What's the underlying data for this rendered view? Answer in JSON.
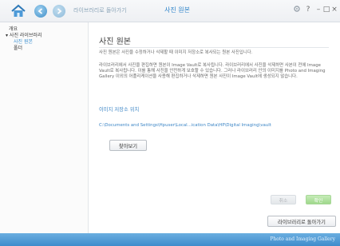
{
  "titlebar": {
    "breadcrumb": "라이브러리로 돌아가기",
    "title": "사진 원본",
    "window_controls": {
      "help_glyph": "?",
      "minimize_glyph": "–",
      "maximize_glyph": "□",
      "close_glyph": "×"
    },
    "icons": [
      "home-icon",
      "back-arrow-icon",
      "forward-arrow-icon",
      "settings-icon"
    ]
  },
  "sidebar": {
    "items": [
      {
        "label": "개요",
        "level": 0,
        "active": false
      },
      {
        "label": "▾ 사진 라이브러리",
        "level": 0,
        "active": false
      },
      {
        "label": "사진 원본",
        "level": 1,
        "active": true
      },
      {
        "label": "폴더",
        "level": 1,
        "active": false
      }
    ]
  },
  "main": {
    "heading": "사진 원본",
    "intro": "사진 원본은 사진을 수정하거나 삭제할 때 이미지 저장소로 복사되는 원본 사진입니다.",
    "description": "라이브러리에서 사진을 편집하면 원본이 Image Vault로 복사됩니다. 라이브러리에서 사진을 삭제하면 사본이 전에 Image Vault로 복사됩니다. 이를 통해 사진을 안전하게 보호할 수 있습니다. 그러나 라이브러리 안의 이미지를 Photo and Imaging Gallery 이외의 어플리케이션을 사용해 편집하거나 삭제하면 원본 사진이 Image Vault에 생성되지 않습니다.",
    "location_heading": "이미지 저장소 위치",
    "location_path": "C:\\Documents and Settings\\Hpuser\\Local...ication Data\\HP\\Digital Imaging\\vault",
    "browse_label": "찾아보기",
    "cancel_label": "취소",
    "ok_label": "확인",
    "return_label": "라이브러리로 돌아가기"
  },
  "footer": {
    "brand": "Photo and Imaging Gallery"
  },
  "colors": {
    "accent": "#3a8fd0",
    "footer": "#4f9bd6",
    "ok_button": "#a8dc94"
  }
}
